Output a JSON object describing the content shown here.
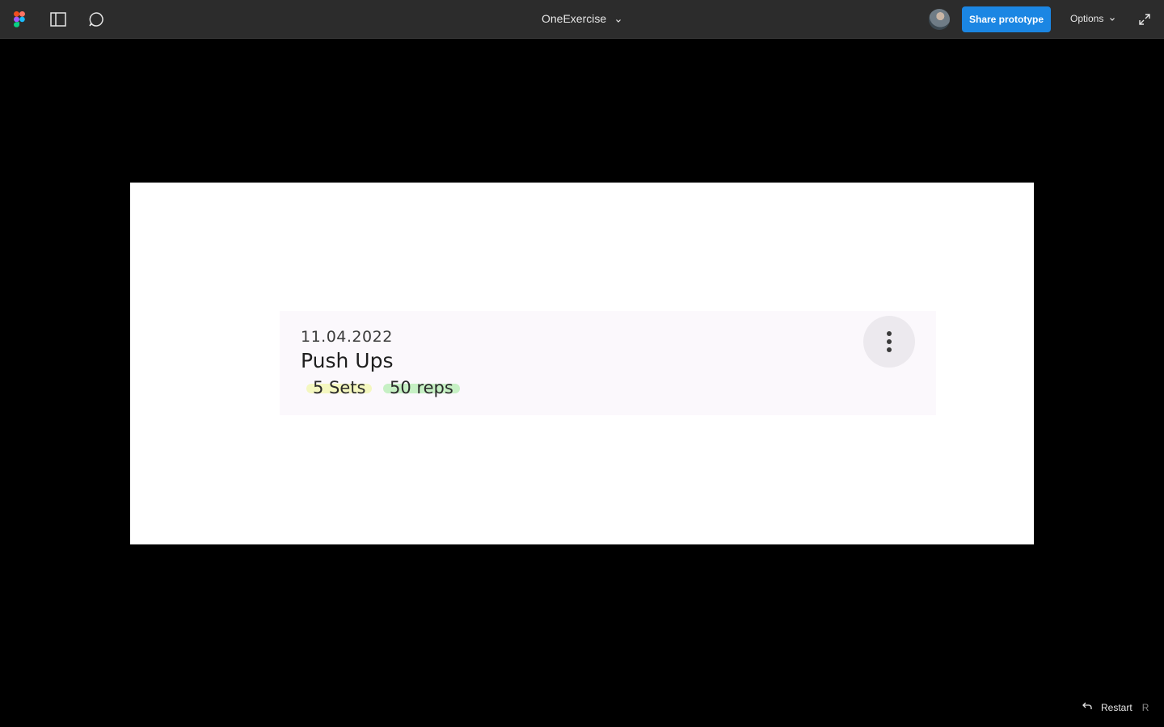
{
  "toolbar": {
    "icons": [
      "figma-logo-icon",
      "sidebar-panel-icon",
      "comment-icon"
    ],
    "file_title": "OneExercise",
    "share_label": "Share prototype",
    "options_label": "Options",
    "expand_icon": "expand-icon"
  },
  "card": {
    "date": "11.04.2022",
    "title": "Push Ups",
    "chips": [
      {
        "label": "5 Sets",
        "highlight_color": "#f4f7c0"
      },
      {
        "label": "50 reps",
        "highlight_color": "#c6f0c4"
      }
    ],
    "more_icon": "more-vertical-icon"
  },
  "footer": {
    "restart_label": "Restart",
    "restart_shortcut": "R"
  },
  "colors": {
    "toolbar_bg": "#2c2c2c",
    "canvas_bg": "#000000",
    "accent": "#1b86e3",
    "card_bg": "#fbf8fc"
  }
}
